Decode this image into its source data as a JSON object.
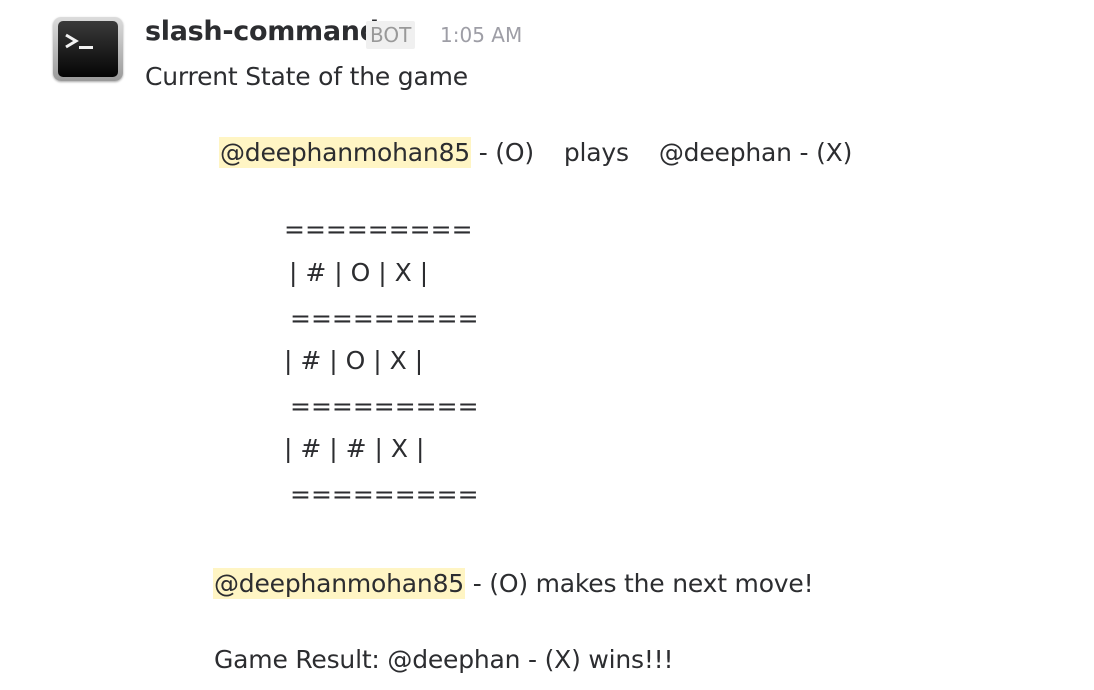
{
  "message": {
    "sender": "slash-command",
    "badge": "BOT",
    "timestamp": "1:05 AM",
    "intro": "Current State of the game",
    "players": {
      "mention_o": "@deephanmohan85",
      "o_suffix": " - (O)",
      "plays": "plays",
      "x_player": "@deephan - (X)"
    },
    "board": [
      "=========",
      "| # | O | X |",
      "=========",
      "| # | O | X |",
      "=========",
      "| # | # | X |",
      "========="
    ],
    "next_move": {
      "mention": "@deephanmohan85",
      "text": " - (O) makes the next move!"
    },
    "result": "Game Result: @deephan - (X) wins!!!"
  },
  "icons": {
    "avatar": "terminal-icon"
  }
}
